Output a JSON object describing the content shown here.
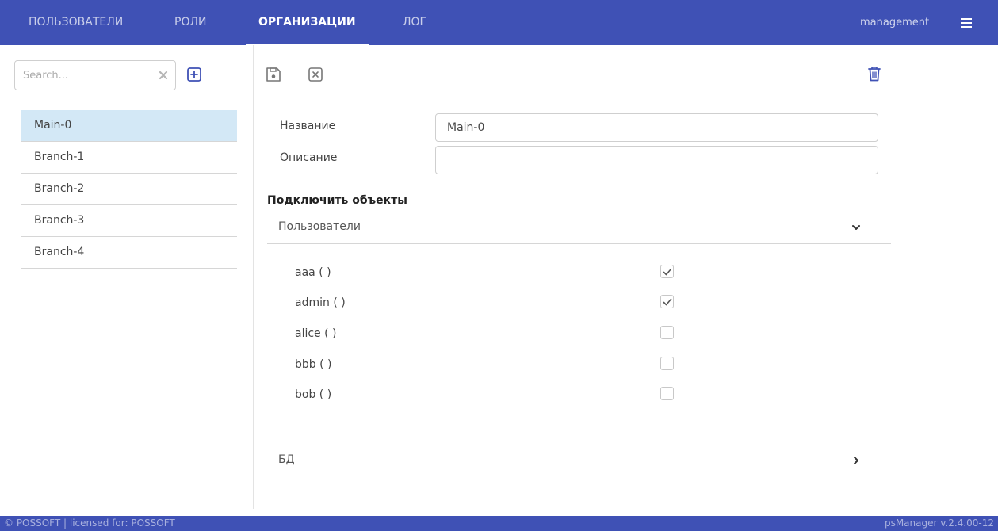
{
  "nav": {
    "tabs": [
      {
        "label": "ПОЛЬЗОВАТЕЛИ"
      },
      {
        "label": "РОЛИ"
      },
      {
        "label": "ОРГАНИЗАЦИИ",
        "active": true
      },
      {
        "label": "ЛОГ"
      }
    ],
    "user": "management"
  },
  "sidebar": {
    "search_placeholder": "Search...",
    "items": [
      {
        "label": "Main-0",
        "selected": true
      },
      {
        "label": "Branch-1"
      },
      {
        "label": "Branch-2"
      },
      {
        "label": "Branch-3"
      },
      {
        "label": "Branch-4"
      }
    ]
  },
  "form": {
    "name_label": "Название",
    "name_value": "Main-0",
    "description_label": "Описание",
    "description_value": ""
  },
  "connect": {
    "title": "Подключить объекты",
    "users_section": {
      "label": "Пользователи",
      "expanded": true,
      "users": [
        {
          "name": "aaa ( )",
          "checked": true
        },
        {
          "name": "admin ( )",
          "checked": true
        },
        {
          "name": "alice ( )",
          "checked": false
        },
        {
          "name": "bbb ( )",
          "checked": false
        },
        {
          "name": "bob ( )",
          "checked": false
        }
      ]
    },
    "db_section": {
      "label": "БД",
      "expanded": false
    }
  },
  "footer": {
    "left": "© POSSOFT | licensed for: POSSOFT",
    "right": "psManager v.2.4.00-12"
  },
  "colors": {
    "brand": "#3f51b5",
    "selected_row": "#d3e8f6",
    "accent_icon": "#3f51b5"
  },
  "icons": {
    "clear": "times-icon",
    "add": "plus-square-icon",
    "save": "save-icon",
    "cancel": "close-square-icon",
    "delete": "trash-icon",
    "menu": "hamburger-menu-icon",
    "expand": "chevron-down-icon",
    "collapse": "chevron-right-icon",
    "check": "check-icon"
  }
}
